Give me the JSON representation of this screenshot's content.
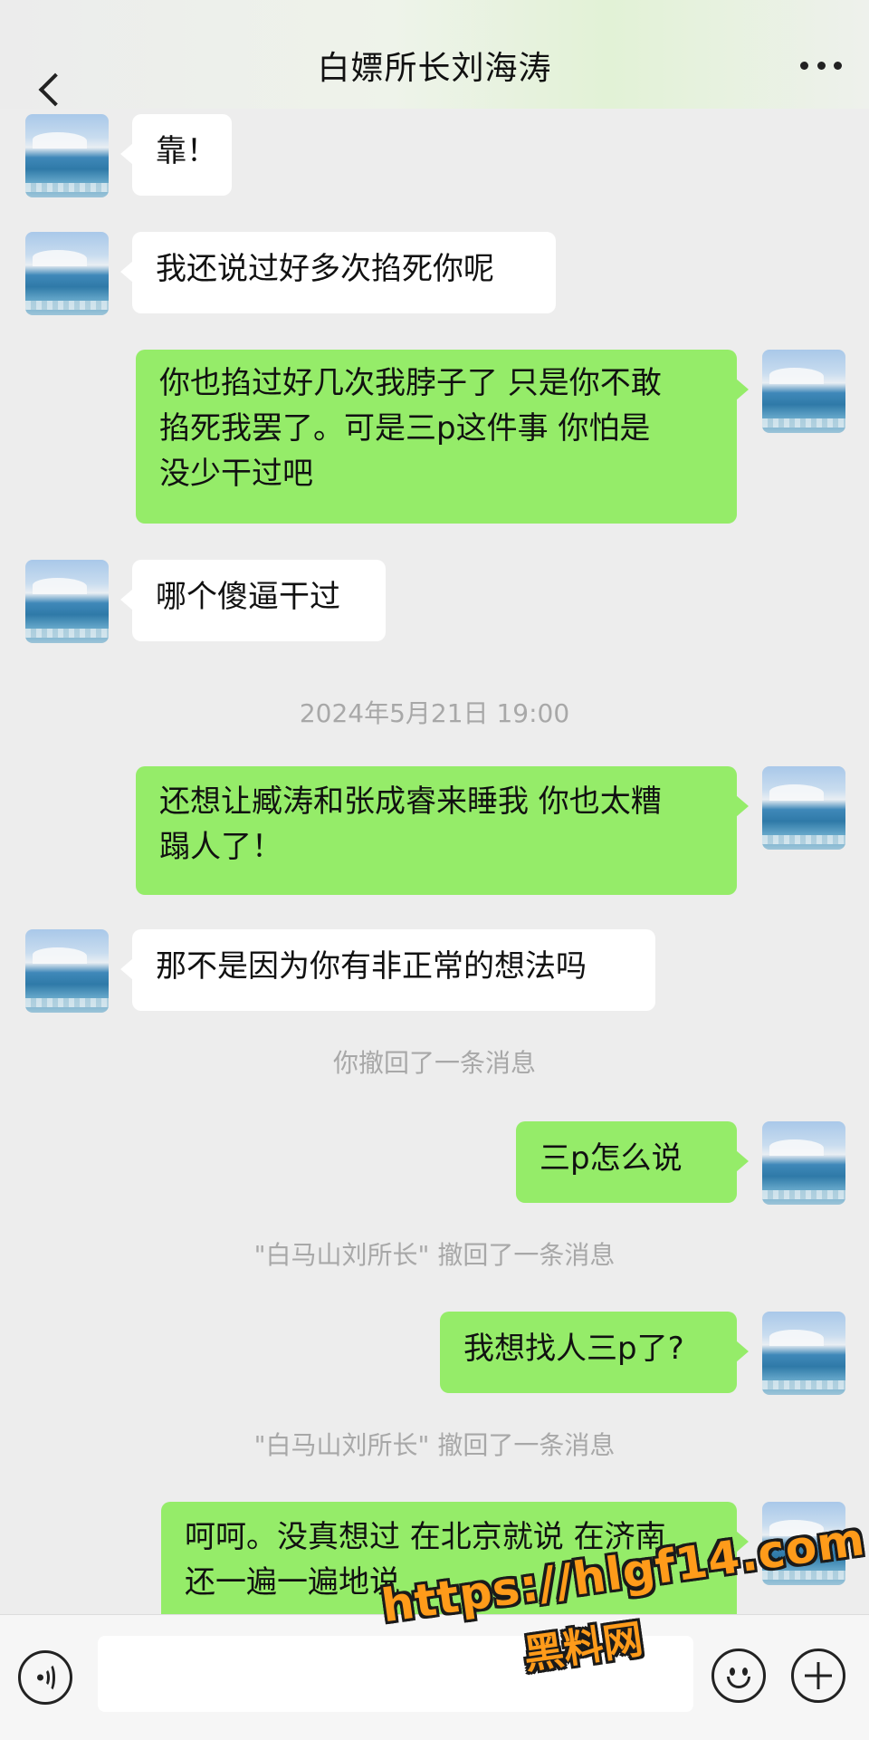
{
  "header": {
    "title": "白嫖所长刘海涛"
  },
  "messages": [
    {
      "side": "in",
      "text": "靠！"
    },
    {
      "side": "in",
      "text": "我还说过好多次掐死你呢"
    },
    {
      "side": "out",
      "line1": "你也掐过好几次我脖子了 只是你不敢",
      "line2": "掐死我罢了。可是三p这件事 你怕是",
      "line3": "没少干过吧"
    },
    {
      "side": "in",
      "text": "哪个傻逼干过"
    },
    {
      "side": "out",
      "line1": "还想让臧涛和张成睿来睡我 你也太糟",
      "line2": "蹋人了！"
    },
    {
      "side": "in",
      "text": "那不是因为你有非正常的想法吗"
    },
    {
      "side": "out",
      "text": "三p怎么说"
    },
    {
      "side": "out",
      "text": "我想找人三p了?"
    },
    {
      "side": "out",
      "line1": "呵呵。没真想过 在北京就说 在济南",
      "line2": "还一遍一遍地说"
    }
  ],
  "system": {
    "timestamp": "2024年5月21日 19:00",
    "you_recalled": "你撤回了一条消息",
    "other_recalled_1": "\"白马山刘所长\" 撤回了一条消息",
    "other_recalled_2": "\"白马山刘所长\" 撤回了一条消息"
  },
  "watermark": {
    "url": "https://hlgf14.com",
    "name": "黑料网"
  },
  "colors": {
    "out_bubble": "#95ec69",
    "in_bubble": "#ffffff",
    "background": "#ededed"
  },
  "icons": [
    "back-icon",
    "more-icon",
    "voice-icon",
    "emoji-icon",
    "plus-icon"
  ]
}
